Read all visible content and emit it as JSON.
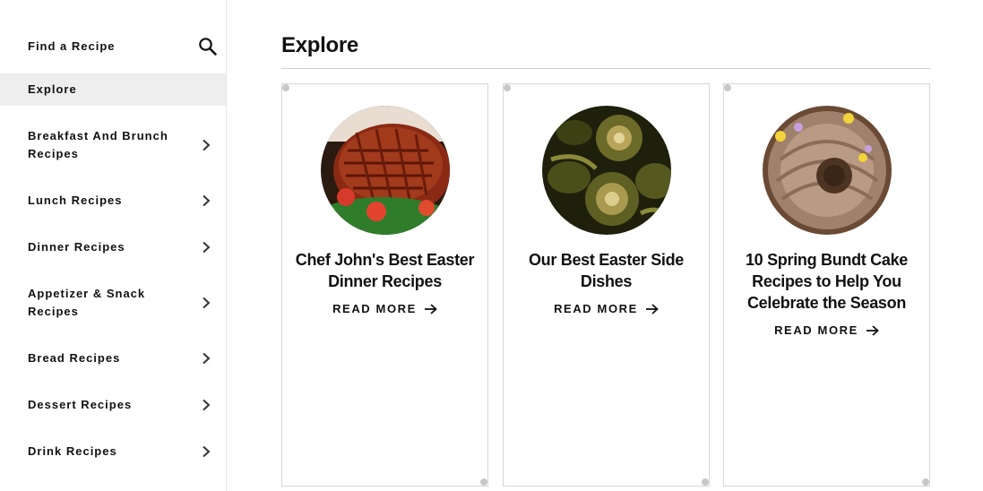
{
  "sidebar": {
    "find_label": "Find a Recipe",
    "search_icon": "search-icon",
    "active_label": "Explore",
    "items": [
      {
        "label_line1": "Breakfast And Brunch",
        "label_line2": "Recipes"
      },
      {
        "label_line1": "Lunch Recipes",
        "label_line2": ""
      },
      {
        "label_line1": "Dinner Recipes",
        "label_line2": ""
      },
      {
        "label_line1": "Appetizer & Snack",
        "label_line2": "Recipes"
      },
      {
        "label_line1": "Bread Recipes",
        "label_line2": ""
      },
      {
        "label_line1": "Dessert Recipes",
        "label_line2": ""
      },
      {
        "label_line1": "Drink Recipes",
        "label_line2": ""
      }
    ],
    "chevron_icon": "chevron-right-icon",
    "active_bg": "#eeeeee"
  },
  "main": {
    "title": "Explore",
    "cards": [
      {
        "title_line1": "Chef John's Best Easter",
        "title_line2": "Dinner Recipes",
        "title_line3": "",
        "cta": "READ MORE",
        "image": "glazed-ham-image"
      },
      {
        "title_line1": "Our Best Easter Side",
        "title_line2": "Dishes",
        "title_line3": "",
        "cta": "READ MORE",
        "image": "artichokes-image"
      },
      {
        "title_line1": "10 Spring Bundt Cake",
        "title_line2": "Recipes to Help You",
        "title_line3": "Celebrate the Season",
        "cta": "READ MORE",
        "image": "bundt-cake-image"
      }
    ]
  }
}
